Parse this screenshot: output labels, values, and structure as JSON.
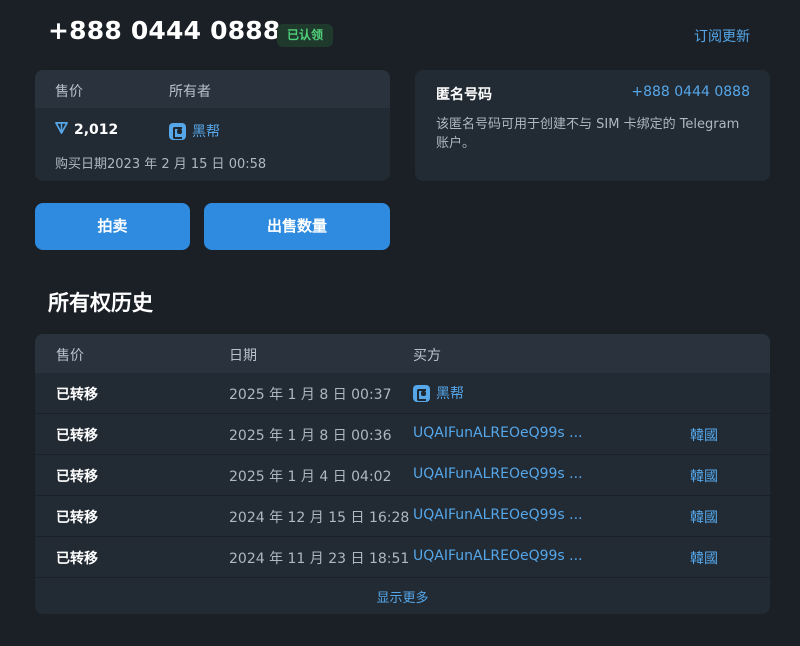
{
  "header": {
    "phone_number": "+888 0444 0888",
    "claimed_badge": "已认领",
    "subscribe_link": "订阅更新"
  },
  "price_card": {
    "price_label": "售价",
    "owner_label": "所有者",
    "price_value": "2,012",
    "price_icon": "ton-diamond-icon",
    "owner_name": "黑帮",
    "owner_icon": "wallet-icon",
    "purchase_date": "购买日期2023 年 2 月 15 日 00:58"
  },
  "anon_card": {
    "title": "匿名号码",
    "number": "+888 0444 0888",
    "description": "该匿名号码可用于创建不与 SIM 卡绑定的 Telegram 账户。"
  },
  "buttons": {
    "auction": "拍卖",
    "sell": "出售数量"
  },
  "history": {
    "title": "所有权历史",
    "columns": [
      "售价",
      "日期",
      "买方"
    ],
    "rows": [
      {
        "status": "已转移",
        "date": "2025 年 1 月 8 日 00:37",
        "buyer": "黑帮",
        "buyer_icon": "wallet-icon",
        "link": ""
      },
      {
        "status": "已转移",
        "date": "2025 年 1 月 8 日 00:36",
        "buyer": "UQAIFunALREOeQ99s ...",
        "link": "韓國"
      },
      {
        "status": "已转移",
        "date": "2025 年 1 月 4 日 04:02",
        "buyer": "UQAIFunALREOeQ99s ...",
        "link": "韓國"
      },
      {
        "status": "已转移",
        "date": "2024 年 12 月 15 日 16:28",
        "buyer": "UQAIFunALREOeQ99s ...",
        "link": "韓國"
      },
      {
        "status": "已转移",
        "date": "2024 年 11 月 23 日 18:51",
        "buyer": "UQAIFunALREOeQ99s ...",
        "link": "韓國"
      }
    ],
    "show_more": "显示更多"
  },
  "colors": {
    "background": "#1a2026",
    "card": "#222a33",
    "accent": "#55a7ea",
    "button": "#2e8be0",
    "badge_green": "#4fcf79"
  }
}
